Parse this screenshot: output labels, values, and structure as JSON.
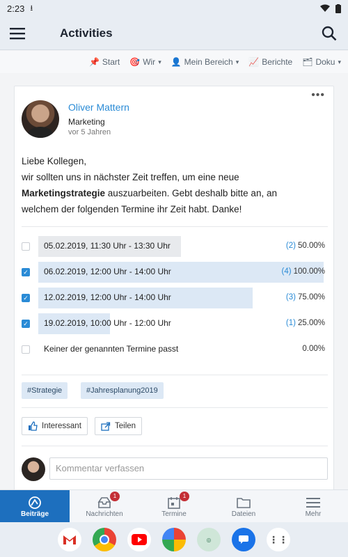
{
  "status": {
    "time": "2:23"
  },
  "appbar": {
    "title": "Activities"
  },
  "topnav": [
    {
      "label": "Start",
      "icon": "pin-icon"
    },
    {
      "label": "Wir",
      "icon": "target-icon",
      "dropdown": true
    },
    {
      "label": "Mein Bereich",
      "icon": "person-icon",
      "dropdown": true
    },
    {
      "label": "Berichte",
      "icon": "chart-icon"
    },
    {
      "label": "Doku",
      "icon": "folder-icon",
      "dropdown": true
    }
  ],
  "post": {
    "author": "Oliver Mattern",
    "department": "Marketing",
    "time_ago": "vor 5 Jahren",
    "text_line1": "Liebe Kollegen,",
    "text_line2": "wir sollten uns in nächster Zeit treffen, um eine neue",
    "text_bold": "Marketingstrategie",
    "text_line3": " auszuarbeiten. Gebt deshalb bitte an, an",
    "text_line4": "welchem der folgenden Termine ihr Zeit habt. Danke!"
  },
  "poll": [
    {
      "label": "05.02.2019, 11:30 Uhr - 13:30 Uhr",
      "count": "(2)",
      "percent": "50.00%",
      "fraction": 0.5,
      "checked": false
    },
    {
      "label": "06.02.2019, 12:00 Uhr - 14:00 Uhr",
      "count": "(4)",
      "percent": "100.00%",
      "fraction": 1.0,
      "checked": true
    },
    {
      "label": "12.02.2019, 12:00 Uhr - 14:00 Uhr",
      "count": "(3)",
      "percent": "75.00%",
      "fraction": 0.75,
      "checked": true
    },
    {
      "label": "19.02.2019, 10:00 Uhr - 12:00 Uhr",
      "count": "(1)",
      "percent": "25.00%",
      "fraction": 0.25,
      "checked": true
    },
    {
      "label": "Keiner der genannten Termine passt",
      "count": "",
      "percent": "0.00%",
      "fraction": 0,
      "checked": false
    }
  ],
  "tags": [
    "#Strategie",
    "#Jahresplanung2019"
  ],
  "actions": {
    "like": "Interessant",
    "share": "Teilen"
  },
  "comment": {
    "placeholder": "Kommentar verfassen"
  },
  "bottomnav": [
    {
      "label": "Beiträge",
      "active": true,
      "badge": ""
    },
    {
      "label": "Nachrichten",
      "active": false,
      "badge": "1"
    },
    {
      "label": "Termine",
      "active": false,
      "badge": "1"
    },
    {
      "label": "Dateien",
      "active": false,
      "badge": ""
    },
    {
      "label": "Mehr",
      "active": false,
      "badge": ""
    }
  ],
  "colors": {
    "accent": "#2a8bd6",
    "nav_active": "#1d6fbe",
    "badge": "#c42f36"
  }
}
